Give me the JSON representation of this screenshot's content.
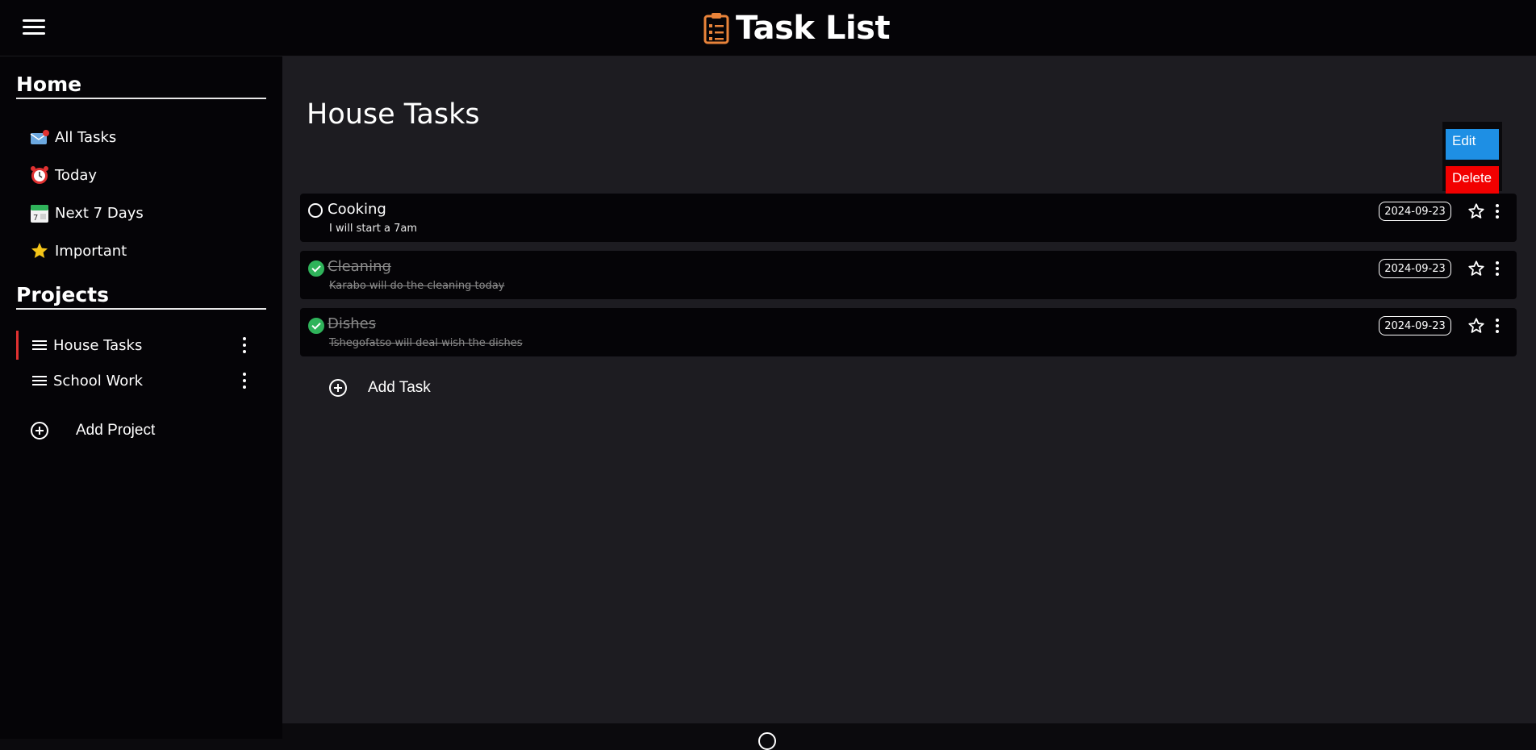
{
  "header": {
    "title": "Task List",
    "menu_icon": "hamburger-icon",
    "logo_icon": "clipboard-icon",
    "logo_color": "#e8833a"
  },
  "sidebar": {
    "home_heading": "Home",
    "home_items": [
      {
        "label": "All Tasks",
        "icon": "envelope-icon"
      },
      {
        "label": "Today",
        "icon": "alarm-clock-icon"
      },
      {
        "label": "Next 7 Days",
        "icon": "calendar-icon"
      },
      {
        "label": "Important",
        "icon": "star-icon"
      }
    ],
    "projects_heading": "Projects",
    "projects": [
      {
        "label": "House Tasks",
        "active": true
      },
      {
        "label": "School Work",
        "active": false
      }
    ],
    "add_project_label": "Add Project"
  },
  "main": {
    "title": "House Tasks",
    "context_menu": {
      "edit_label": "Edit",
      "delete_label": "Delete",
      "edit_color": "#1e8fe4",
      "delete_color": "#f20000"
    },
    "tasks": [
      {
        "title": "Cooking",
        "description": "I will start a 7am",
        "date": "2024-09-23",
        "completed": false
      },
      {
        "title": "Cleaning",
        "description": "Karabo will do the cleaning today",
        "date": "2024-09-23",
        "completed": true
      },
      {
        "title": "Dishes",
        "description": "Tshegofatso will deal wish the dishes",
        "date": "2024-09-23",
        "completed": true
      }
    ],
    "add_task_label": "Add Task"
  },
  "colors": {
    "sidebar_bg": "#050407",
    "main_bg": "#1d1c21",
    "active_accent": "#e03131",
    "done_check": "#2fb35a"
  }
}
